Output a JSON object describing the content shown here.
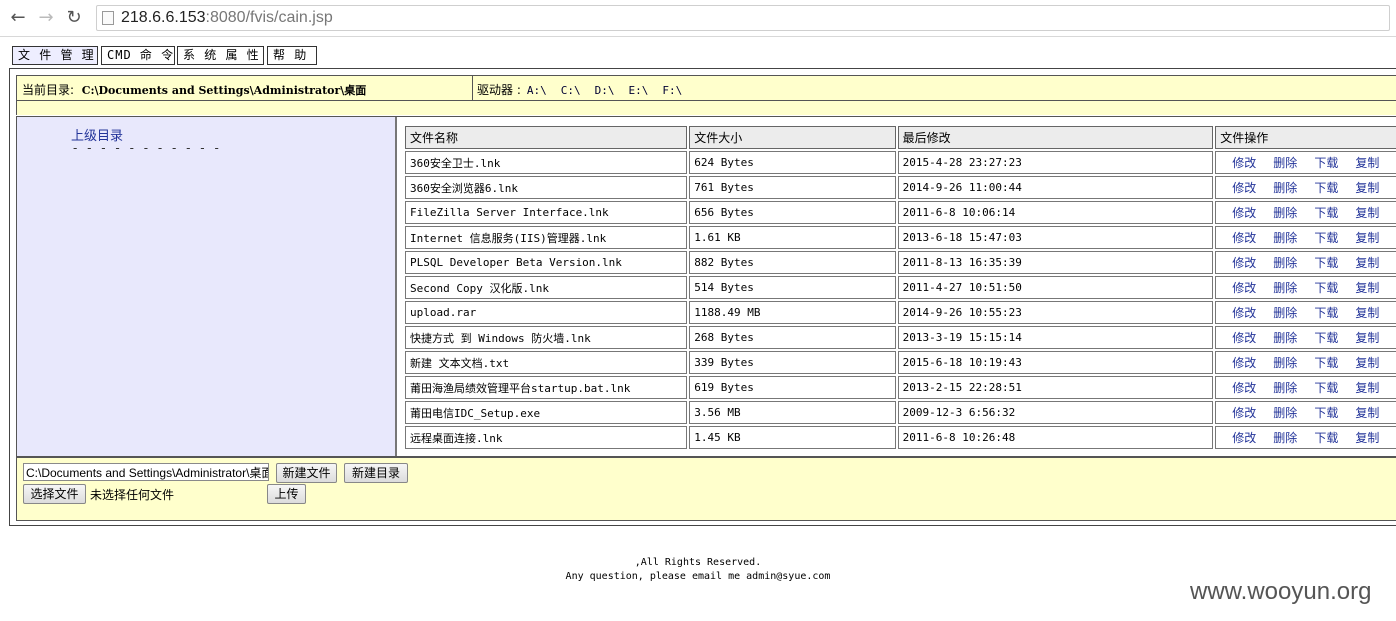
{
  "browser": {
    "url_host": "218.6.6.153",
    "url_path": ":8080/fvis/cain.jsp"
  },
  "menu": [
    "文 件 管 理",
    "CMD 命 令",
    "系 统 属 性",
    "帮 助"
  ],
  "path_bar": {
    "current_dir_label": "当前目录:",
    "current_dir": "C:\\Documents and Settings\\Administrator\\桌面",
    "drives_label": "驱动器 :",
    "drives": [
      "A:\\",
      "C:\\",
      "D:\\",
      "E:\\",
      "F:\\"
    ]
  },
  "sidebar": {
    "up_link": "上级目录",
    "dashes": "- - - - - - - - - - -"
  },
  "table": {
    "headers": [
      "文件名称",
      "文件大小",
      "最后修改",
      "文件操作"
    ],
    "ops": [
      "修改",
      "删除",
      "下载",
      "复制"
    ],
    "rows": [
      {
        "name": "360安全卫士.lnk",
        "size": "624 Bytes",
        "modified": "2015-4-28 23:27:23"
      },
      {
        "name": "360安全浏览器6.lnk",
        "size": "761 Bytes",
        "modified": "2014-9-26 11:00:44"
      },
      {
        "name": "FileZilla Server Interface.lnk",
        "size": "656 Bytes",
        "modified": "2011-6-8 10:06:14"
      },
      {
        "name": "Internet 信息服务(IIS)管理器.lnk",
        "size": "1.61 KB",
        "modified": "2013-6-18 15:47:03"
      },
      {
        "name": "PLSQL Developer Beta Version.lnk",
        "size": "882 Bytes",
        "modified": "2011-8-13 16:35:39"
      },
      {
        "name": "Second Copy 汉化版.lnk",
        "size": "514 Bytes",
        "modified": "2011-4-27 10:51:50"
      },
      {
        "name": "upload.rar",
        "size": "1188.49 MB",
        "modified": "2014-9-26 10:55:23"
      },
      {
        "name": "快捷方式 到 Windows 防火墙.lnk",
        "size": "268 Bytes",
        "modified": "2013-3-19 15:15:14"
      },
      {
        "name": "新建 文本文档.txt",
        "size": "339 Bytes",
        "modified": "2015-6-18 10:19:43"
      },
      {
        "name": "莆田海渔局绩效管理平台startup.bat.lnk",
        "size": "619 Bytes",
        "modified": "2013-2-15 22:28:51"
      },
      {
        "name": "莆田电信IDC_Setup.exe",
        "size": "3.56 MB",
        "modified": "2009-12-3 6:56:32"
      },
      {
        "name": "远程桌面连接.lnk",
        "size": "1.45 KB",
        "modified": "2011-6-8 10:26:48"
      }
    ]
  },
  "bottom": {
    "path_value": "C:\\Documents and Settings\\Administrator\\桌面",
    "new_file": "新建文件",
    "new_dir": "新建目录",
    "choose_file": "选择文件",
    "no_file": "未选择任何文件",
    "upload": "上传"
  },
  "footer": {
    "line1": ",All Rights Reserved.",
    "line2": "Any question, please email me admin@syue.com"
  },
  "watermark": "www.wooyun.org"
}
